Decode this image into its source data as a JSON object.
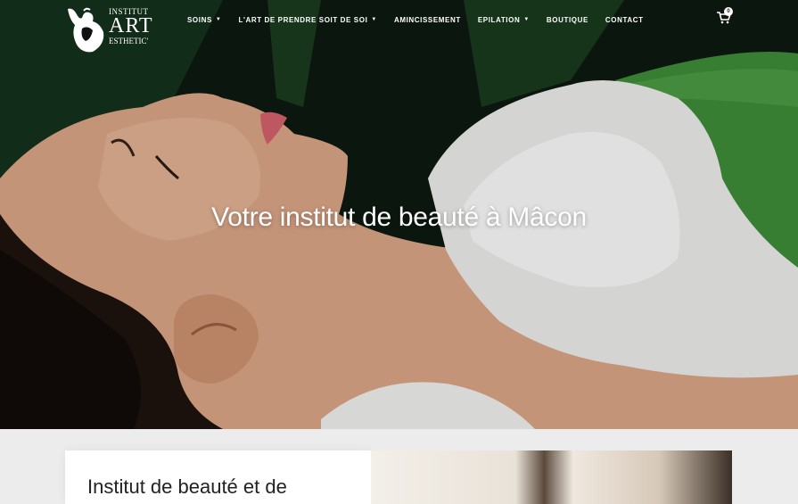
{
  "brand": {
    "line1": "INSTITUT",
    "line2": "ART",
    "line3": "ESTHETIC'"
  },
  "nav": {
    "items": [
      {
        "label": "SOINS",
        "dropdown": true
      },
      {
        "label": "L'ART DE PRENDRE SOIT DE SOI",
        "dropdown": true
      },
      {
        "label": "AMINCISSEMENT",
        "dropdown": false
      },
      {
        "label": "EPILATION",
        "dropdown": true
      },
      {
        "label": "BOUTIQUE",
        "dropdown": false
      },
      {
        "label": "CONTACT",
        "dropdown": false
      }
    ],
    "chevron": "⌄"
  },
  "cart": {
    "icon": "shopping-cart-icon",
    "count": "0"
  },
  "hero": {
    "title": "Votre institut de beauté à Mâcon"
  },
  "intro": {
    "title": "Institut de beauté et de"
  },
  "colors": {
    "text_dark": "#222222",
    "background": "#ececec",
    "white": "#ffffff"
  }
}
